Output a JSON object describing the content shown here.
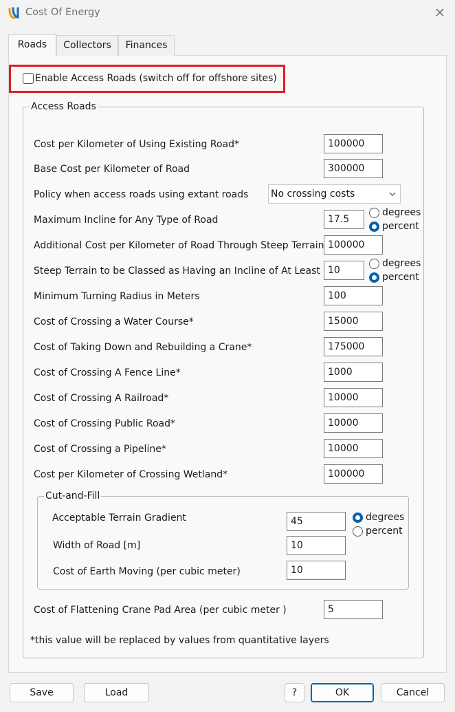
{
  "window": {
    "title": "Cost Of Energy"
  },
  "tabs": [
    {
      "label": "Roads"
    },
    {
      "label": "Collectors"
    },
    {
      "label": "Finances"
    }
  ],
  "enable_access_roads": {
    "label": "Enable Access Roads (switch off for offshore sites)",
    "checked": false
  },
  "access_roads": {
    "legend": "Access Roads",
    "existing_road_cost": {
      "label": "Cost per Kilometer of Using Existing Road*",
      "value": "100000"
    },
    "base_cost": {
      "label": "Base Cost per Kilometer of Road",
      "value": "300000"
    },
    "policy": {
      "label": "Policy when access roads using extant roads",
      "selected": "No crossing costs"
    },
    "max_incline": {
      "label": "Maximum Incline for Any Type of Road",
      "value": "17.5",
      "unit_degrees": "degrees",
      "unit_percent": "percent",
      "selected_unit": "percent"
    },
    "steep_cost": {
      "label": "Additional Cost per Kilometer of Road Through Steep Terrain",
      "value": "100000"
    },
    "steep_threshold": {
      "label": "Steep Terrain to be Classed as Having an Incline of At Least",
      "value": "10",
      "unit_degrees": "degrees",
      "unit_percent": "percent",
      "selected_unit": "percent"
    },
    "turning_radius": {
      "label": "Minimum Turning Radius in Meters",
      "value": "100"
    },
    "water_course": {
      "label": "Cost of Crossing a Water Course*",
      "value": "15000"
    },
    "crane_rebuild": {
      "label": "Cost of Taking Down and Rebuilding a Crane*",
      "value": "175000"
    },
    "fence_line": {
      "label": "Cost of Crossing A Fence Line*",
      "value": "1000"
    },
    "railroad": {
      "label": "Cost of Crossing A Railroad*",
      "value": "10000"
    },
    "public_road": {
      "label": "Cost of Crossing Public Road*",
      "value": "10000"
    },
    "pipeline": {
      "label": "Cost of Crossing a Pipeline*",
      "value": "10000"
    },
    "wetland": {
      "label": "Cost per Kilometer of Crossing Wetland*",
      "value": "100000"
    },
    "cut_and_fill": {
      "legend": "Cut-and-Fill",
      "terrain_gradient": {
        "label": "Acceptable Terrain Gradient",
        "value": "45",
        "unit_degrees": "degrees",
        "unit_percent": "percent",
        "selected_unit": "degrees"
      },
      "road_width": {
        "label": "Width of Road [m]",
        "value": "10"
      },
      "earth_moving": {
        "label": "Cost of Earth Moving (per cubic meter)",
        "value": "10"
      }
    },
    "crane_pad": {
      "label": "Cost of Flattening Crane Pad Area (per cubic meter )",
      "value": "5"
    },
    "footnote": "*this value will be replaced by values from quantitative layers"
  },
  "buttons": {
    "save": "Save",
    "load": "Load",
    "help": "?",
    "ok": "OK",
    "cancel": "Cancel"
  },
  "colors": {
    "highlight": "#e11d26",
    "accent": "#0063b1"
  }
}
